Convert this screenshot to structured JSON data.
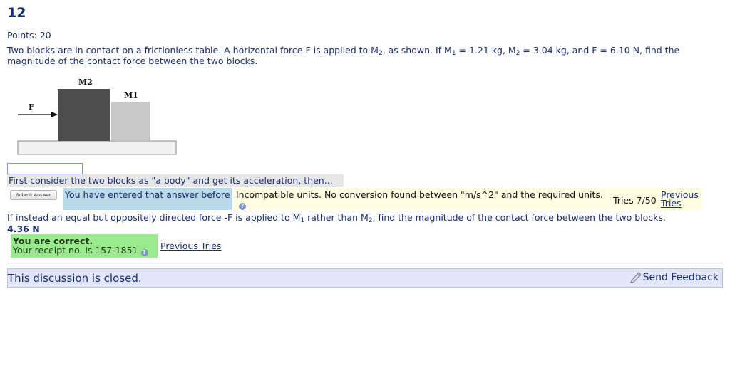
{
  "problem": {
    "number": "12",
    "points": "Points: 20",
    "question_lines": [
      "Two blocks are in contact on a frictionless table. A horizontal force F is applied to M",
      "2",
      ", as shown. If M",
      "1",
      " = 1.21 kg, M",
      "2",
      " = 3.04 kg, and F = 6.10 N, find the",
      "magnitude of the contact force between the two blocks."
    ],
    "figure": {
      "label_m2": "M2",
      "label_m1": "M1",
      "label_f": "F"
    }
  },
  "part_a": {
    "input_value": "",
    "hint": "First consider the two blocks as \"a body\" and get its acceleration, then...",
    "submit_label": "Submit Answer",
    "same_answer_msg": "You have entered that answer before",
    "units_msg": "Incompatible units. No conversion found between \"m/s^2\" and the required units.",
    "tries": "Tries 7/50",
    "previous_tries": "Previous Tries"
  },
  "part_b": {
    "text_parts": [
      "If instead an equal but oppositely directed force -F is applied to M",
      "1",
      " rather than M",
      "2",
      ", find the magnitude of the contact force between the two blocks."
    ],
    "answer": "4.36 N",
    "correct_title": "You are correct.",
    "receipt": "Your receipt no. is 157-1851",
    "previous_tries": "Previous Tries"
  },
  "footer": {
    "closed_text": "This discussion is closed.",
    "feedback_label": "Send Feedback"
  },
  "colors": {
    "text": "#1a2d6e",
    "hint_bg": "#e6e6e6",
    "same_answer_bg": "#b9d8e8",
    "units_bg": "#fffde2",
    "correct_bg": "#98ea8c",
    "closed_bg": "#e2e6fb"
  },
  "icons": [
    "help-icon",
    "feedback-icon",
    "arrow-icon"
  ]
}
